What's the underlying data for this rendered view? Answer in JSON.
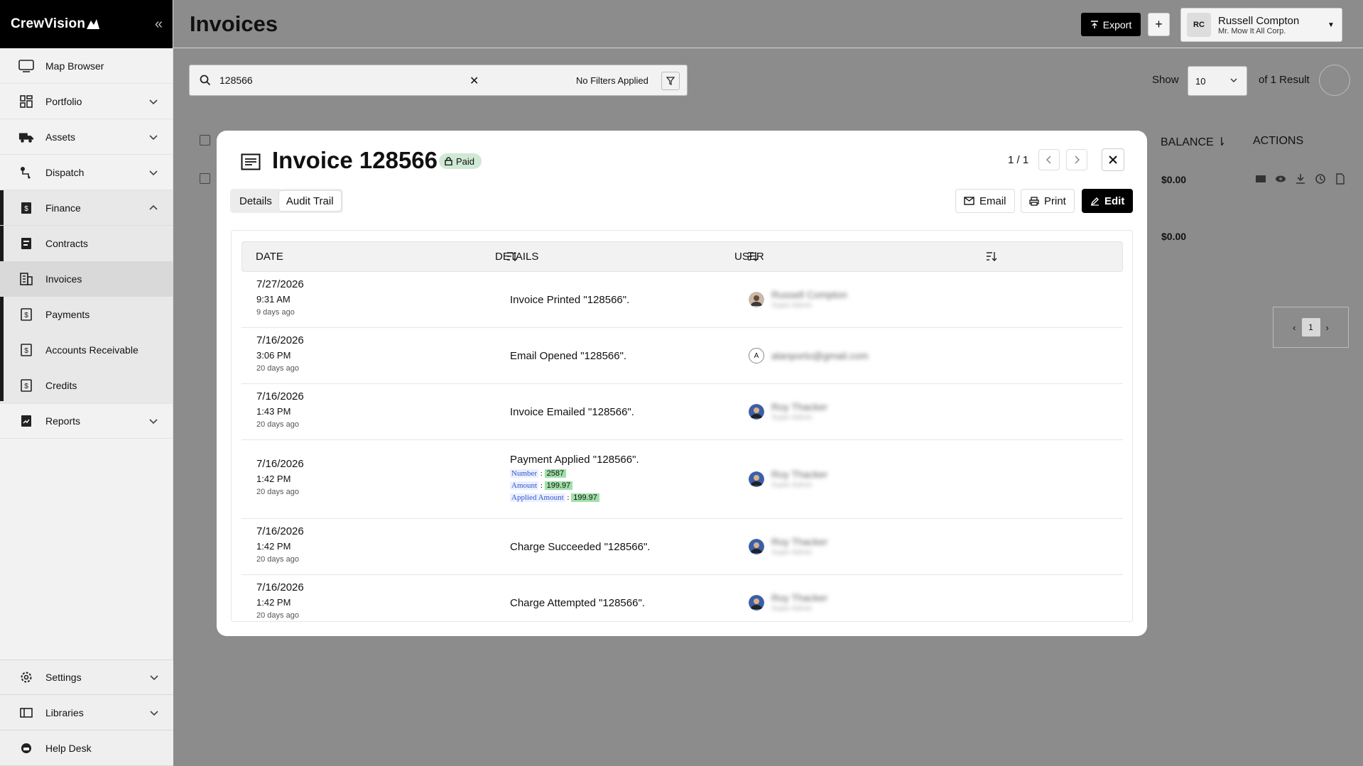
{
  "brand": {
    "name": "CrewVision"
  },
  "sidebar": {
    "items": [
      {
        "label": "Map Browser"
      },
      {
        "label": "Portfolio"
      },
      {
        "label": "Assets"
      },
      {
        "label": "Dispatch"
      },
      {
        "label": "Finance"
      },
      {
        "label": "Contracts"
      },
      {
        "label": "Invoices"
      },
      {
        "label": "Payments"
      },
      {
        "label": "Accounts Receivable"
      },
      {
        "label": "Credits"
      },
      {
        "label": "Reports"
      }
    ],
    "bottom": [
      {
        "label": "Settings"
      },
      {
        "label": "Libraries"
      },
      {
        "label": "Help Desk"
      }
    ]
  },
  "header": {
    "title": "Invoices",
    "export_label": "Export",
    "plus_label": "+",
    "user": {
      "initials": "RC",
      "name": "Russell Compton",
      "company": "Mr. Mow It All Corp."
    }
  },
  "toolbar": {
    "search_value": "128566",
    "filters_label": "No Filters Applied",
    "show_label": "Show",
    "show_value": "10",
    "result_label": "of 1 Result"
  },
  "table": {
    "col_balance": "BALANCE",
    "col_actions": "ACTIONS",
    "row_balance": "$0.00",
    "total_balance": "$0.00",
    "page": "1"
  },
  "modal": {
    "title": "Invoice 128566",
    "status": "Paid",
    "counter": "1 / 1",
    "tabs": [
      {
        "label": "Details"
      },
      {
        "label": "Audit Trail"
      }
    ],
    "buttons": {
      "email": "Email",
      "print": "Print",
      "edit": "Edit"
    },
    "audit": {
      "columns": [
        "DATE",
        "DETAILS",
        "USER"
      ],
      "rows": [
        {
          "date": "7/27/2026",
          "time": "9:31 AM",
          "ago": "9 days ago",
          "details": "Invoice Printed \"128566\".",
          "user": "Russell Compton",
          "role": "Super Admin",
          "avatar": "photo"
        },
        {
          "date": "7/16/2026",
          "time": "3:06 PM",
          "ago": "20 days ago",
          "details": "Email Opened \"128566\".",
          "user": "alanporto@gmail.com",
          "role": "",
          "avatar": "A"
        },
        {
          "date": "7/16/2026",
          "time": "1:43 PM",
          "ago": "20 days ago",
          "details": "Invoice Emailed \"128566\".",
          "user": "Roy Thacker",
          "role": "Super Admin",
          "avatar": "photo"
        },
        {
          "date": "7/16/2026",
          "time": "1:42 PM",
          "ago": "20 days ago",
          "details": "Payment Applied \"128566\".",
          "user": "Roy Thacker",
          "role": "Super Admin",
          "avatar": "photo",
          "meta": [
            {
              "key": "Number",
              "value": "2587"
            },
            {
              "key": "Amount",
              "value": "199.97"
            },
            {
              "key": "Applied Amount",
              "value": "199.97"
            }
          ]
        },
        {
          "date": "7/16/2026",
          "time": "1:42 PM",
          "ago": "20 days ago",
          "details": "Charge Succeeded \"128566\".",
          "user": "Roy Thacker",
          "role": "Super Admin",
          "avatar": "photo"
        },
        {
          "date": "7/16/2026",
          "time": "1:42 PM",
          "ago": "20 days ago",
          "details": "Charge Attempted \"128566\".",
          "user": "Roy Thacker",
          "role": "Super Admin",
          "avatar": "photo"
        }
      ]
    }
  }
}
